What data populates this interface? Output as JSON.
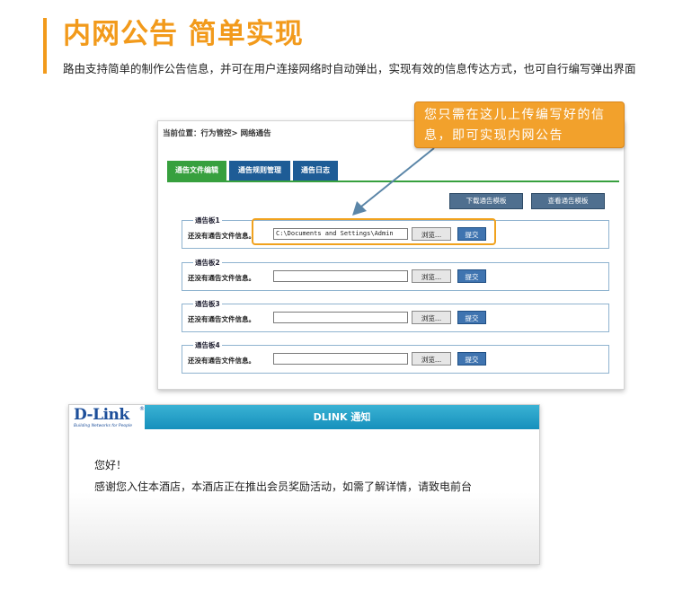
{
  "header": {
    "title": "内网公告 简单实现",
    "subtitle": "路由支持简单的制作公告信息，并可在用户连接网络时自动弹出，实现有效的信息传达方式，也可自行编写弹出界面"
  },
  "callout": {
    "line1": "您只需在这儿上传编写好的信",
    "line2": "息，即可实现内网公告"
  },
  "panel": {
    "breadcrumb": "当前位置：行为管控> 网络通告",
    "tabs": [
      {
        "label": "通告文件编辑",
        "active": true
      },
      {
        "label": "通告规则管理",
        "active": false
      },
      {
        "label": "通告日志",
        "active": false
      }
    ],
    "download_template_label": "下载通告模板",
    "view_template_label": "查看通告模板",
    "boards": [
      {
        "legend": "通告板1",
        "label": "还没有通告文件信息。",
        "file_value": "C:\\Documents and Settings\\Admin",
        "browse_label": "浏览...",
        "submit_label": "提交"
      },
      {
        "legend": "通告板2",
        "label": "还没有通告文件信息。",
        "file_value": "",
        "browse_label": "浏览...",
        "submit_label": "提交"
      },
      {
        "legend": "通告板3",
        "label": "还没有通告文件信息。",
        "file_value": "",
        "browse_label": "浏览...",
        "submit_label": "提交"
      },
      {
        "legend": "通告板4",
        "label": "还没有通告文件信息。",
        "file_value": "",
        "browse_label": "浏览...",
        "submit_label": "提交"
      }
    ]
  },
  "popup": {
    "logo_text": "D-Link",
    "logo_reg": "®",
    "logo_tagline": "Building Networks for People",
    "title": "DLINK 通知",
    "greeting": "您好！",
    "message": "感谢您入住本酒店，本酒店正在推出会员奖励活动，如需了解详情，请致电前台"
  },
  "colors": {
    "accent": "#f29a1b",
    "tab_active": "#37a03e",
    "tab_normal": "#1e5c96",
    "popup_bar": "#1690bc",
    "logo": "#1d4f9a"
  }
}
